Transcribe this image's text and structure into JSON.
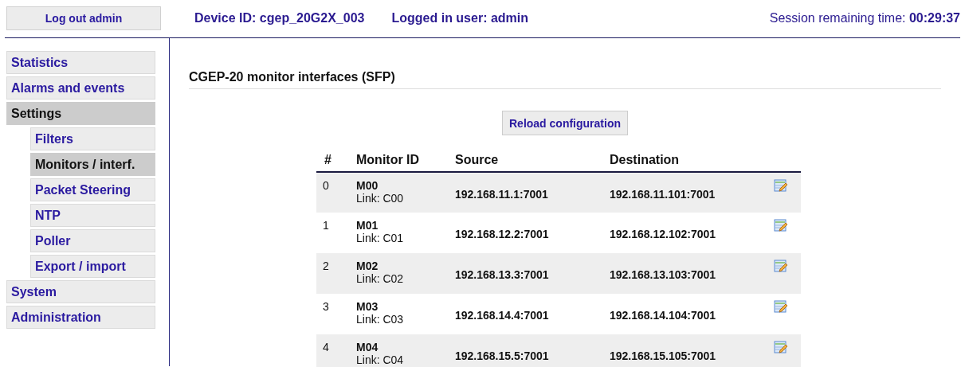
{
  "header": {
    "logout_button": "Log out admin",
    "device_id": "Device ID: cgep_20G2X_003",
    "logged_in": "Logged in user: admin",
    "session_label": "Session remaining time:",
    "session_time": "00:29:37"
  },
  "sidebar": {
    "items": [
      {
        "label": "Statistics",
        "selected": false
      },
      {
        "label": "Alarms and events",
        "selected": false
      },
      {
        "label": "Settings",
        "selected": true,
        "children": [
          {
            "label": "Filters",
            "selected": false
          },
          {
            "label": "Monitors / interf.",
            "selected": true
          },
          {
            "label": "Packet Steering",
            "selected": false
          },
          {
            "label": "NTP",
            "selected": false
          },
          {
            "label": "Poller",
            "selected": false
          },
          {
            "label": "Export / import",
            "selected": false
          }
        ]
      },
      {
        "label": "System",
        "selected": false
      },
      {
        "label": "Administration",
        "selected": false
      }
    ]
  },
  "content": {
    "title": "CGEP-20 monitor interfaces (SFP)",
    "reload_button": "Reload configuration",
    "table": {
      "columns": [
        "#",
        "Monitor ID",
        "Source",
        "Destination"
      ],
      "rows": [
        {
          "index": "0",
          "monitor": "M00",
          "link": "Link: C00",
          "source": "192.168.11.1:7001",
          "destination": "192.168.11.101:7001"
        },
        {
          "index": "1",
          "monitor": "M01",
          "link": "Link: C01",
          "source": "192.168.12.2:7001",
          "destination": "192.168.12.102:7001"
        },
        {
          "index": "2",
          "monitor": "M02",
          "link": "Link: C02",
          "source": "192.168.13.3:7001",
          "destination": "192.168.13.103:7001"
        },
        {
          "index": "3",
          "monitor": "M03",
          "link": "Link: C03",
          "source": "192.168.14.4:7001",
          "destination": "192.168.14.104:7001"
        },
        {
          "index": "4",
          "monitor": "M04",
          "link": "Link: C04",
          "source": "192.168.15.5:7001",
          "destination": "192.168.15.105:7001"
        }
      ]
    }
  }
}
